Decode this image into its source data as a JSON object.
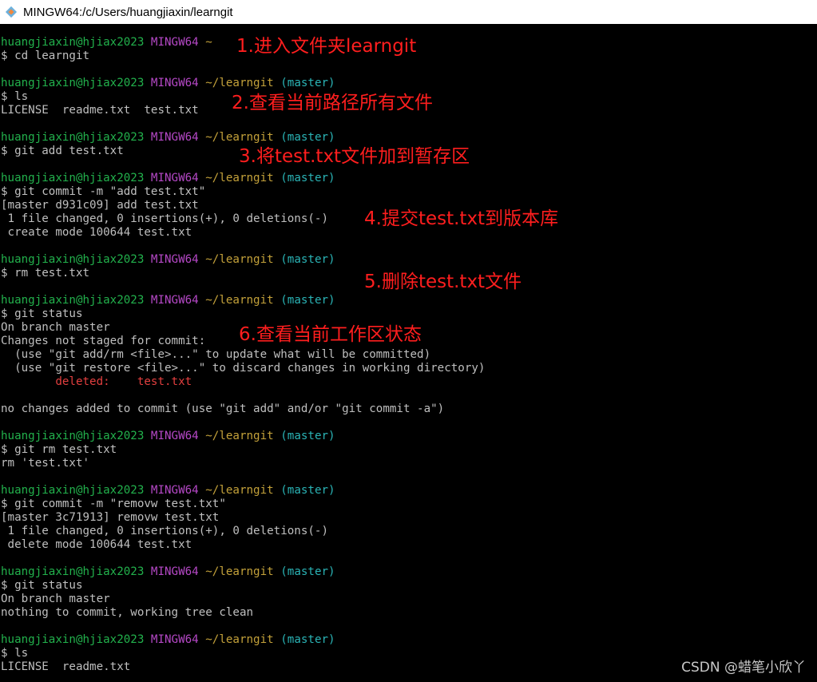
{
  "window": {
    "title": "MINGW64:/c/Users/huangjiaxin/learngit",
    "icon": "git-bash-icon"
  },
  "prompt": {
    "user": "huangjiaxin@hjiax2023",
    "host": "MINGW64",
    "home_path": "~",
    "repo_path": "~/learngit",
    "branch": "(master)"
  },
  "commands": {
    "c1": "$ cd learngit",
    "c2": "$ ls",
    "c3": "$ git add test.txt",
    "c4": "$ git commit -m \"add test.txt\"",
    "c5": "$ rm test.txt",
    "c6": "$ git status",
    "c7": "$ git rm test.txt",
    "c8": "$ git commit -m \"removw test.txt\"",
    "c9": "$ git status",
    "c10": "$ ls"
  },
  "outputs": {
    "ls1": "LICENSE  readme.txt  test.txt",
    "commit1_a": "[master d931c09] add test.txt",
    "commit1_b": " 1 file changed, 0 insertions(+), 0 deletions(-)",
    "commit1_c": " create mode 100644 test.txt",
    "status1_a": "On branch master",
    "status1_b": "Changes not staged for commit:",
    "status1_c": "  (use \"git add/rm <file>...\" to update what will be committed)",
    "status1_d": "  (use \"git restore <file>...\" to discard changes in working directory)",
    "status1_e": "        deleted:    test.txt",
    "status1_f": "no changes added to commit (use \"git add\" and/or \"git commit -a\")",
    "rm_out": "rm 'test.txt'",
    "commit2_a": "[master 3c71913] removw test.txt",
    "commit2_b": " 1 file changed, 0 insertions(+), 0 deletions(-)",
    "commit2_c": " delete mode 100644 test.txt",
    "status2_a": "On branch master",
    "status2_b": "nothing to commit, working tree clean",
    "ls2": "LICENSE  readme.txt"
  },
  "annotations": {
    "a1": "1.进入文件夹learngit",
    "a2": "2.查看当前路径所有文件",
    "a3": "3.将test.txt文件加到暂存区",
    "a4": "4.提交test.txt到版本库",
    "a5": "5.删除test.txt文件",
    "a6": "6.查看当前工作区状态"
  },
  "watermark": "CSDN @蜡笔小欣丫",
  "colors": {
    "user": "#22b14c",
    "host": "#b548c6",
    "path": "#c3a13a",
    "branch": "#2ab3b5",
    "deleted": "#e33f3f",
    "annotation": "#ff1e1e"
  }
}
